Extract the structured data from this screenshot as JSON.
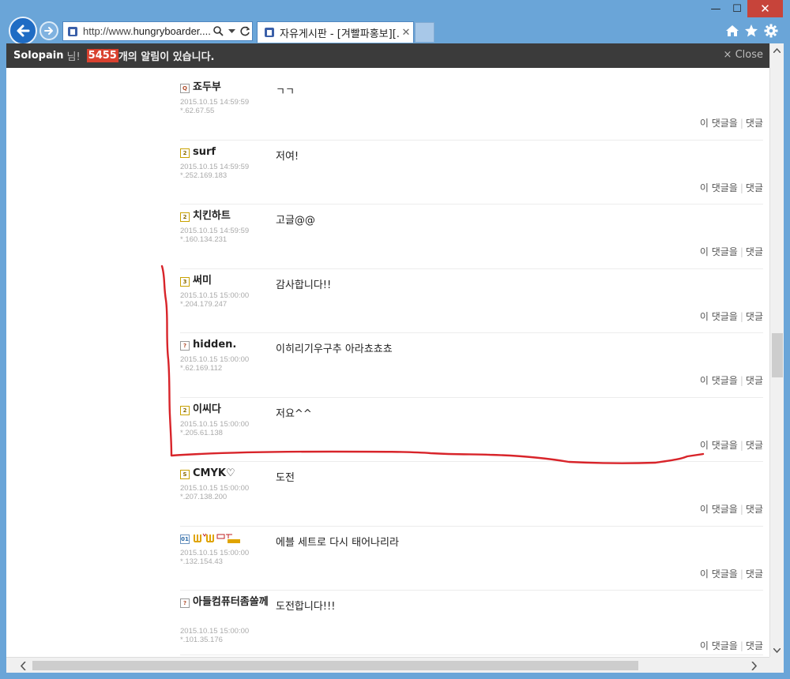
{
  "browser": {
    "url_prefix": "http://www.",
    "url_domain": "hungryboarder....",
    "tab_title": "자유게시판 - [겨빨파홍보][...",
    "tab_close": "✕",
    "win_min": "—",
    "win_max": "☐",
    "win_close": "✕",
    "icons": [
      "back-arrow-icon",
      "forward-arrow-icon",
      "search-icon",
      "dropdown-icon",
      "refresh-icon",
      "home-icon",
      "star-icon",
      "gear-icon"
    ]
  },
  "notification": {
    "user": "Solopain",
    "honorific": "님!",
    "count": "5455",
    "message": "개의 알림이 있습니다.",
    "close_label": "× Close"
  },
  "comments": [
    {
      "level": "Q",
      "nick": "죠두부",
      "date": "2015.10.15 14:59:59",
      "ip": "*.62.67.55",
      "body": "ㄱㄱ"
    },
    {
      "level": "2",
      "nick": "surf",
      "date": "2015.10.15 14:59:59",
      "ip": "*.252.169.183",
      "body": "저여!"
    },
    {
      "level": "2",
      "nick": "치킨하트",
      "date": "2015.10.15 14:59:59",
      "ip": "*.160.134.231",
      "body": "고글@@"
    },
    {
      "level": "3",
      "nick": "써미",
      "date": "2015.10.15 15:00:00",
      "ip": "*.204.179.247",
      "body": "감사합니다!!"
    },
    {
      "level": "?",
      "nick": "hidden.",
      "date": "2015.10.15 15:00:00",
      "ip": "*.62.169.112",
      "body": "이히리기우구추 아라쵸쵸쵸"
    },
    {
      "level": "2",
      "nick": "이씨다",
      "date": "2015.10.15 15:00:00",
      "ip": "*.205.61.138",
      "body": "저요^^"
    },
    {
      "level": "S",
      "nick": "CMYK♡",
      "date": "2015.10.15 15:00:00",
      "ip": "*.207.138.200",
      "body": "도전"
    },
    {
      "level": "01",
      "nick": "",
      "date": "2015.10.15 15:00:00",
      "ip": "*.132.154.43",
      "body": "에블 세트로 다시 태어나리라"
    },
    {
      "level": "?",
      "nick": "아들컴퓨터좀쓸께",
      "date": "2015.10.15 15:00:00",
      "ip": "*.101.35.176",
      "body": "도전합니다!!!"
    }
  ],
  "actions": {
    "reply_to": "이 댓글을",
    "reply": "댓글"
  }
}
